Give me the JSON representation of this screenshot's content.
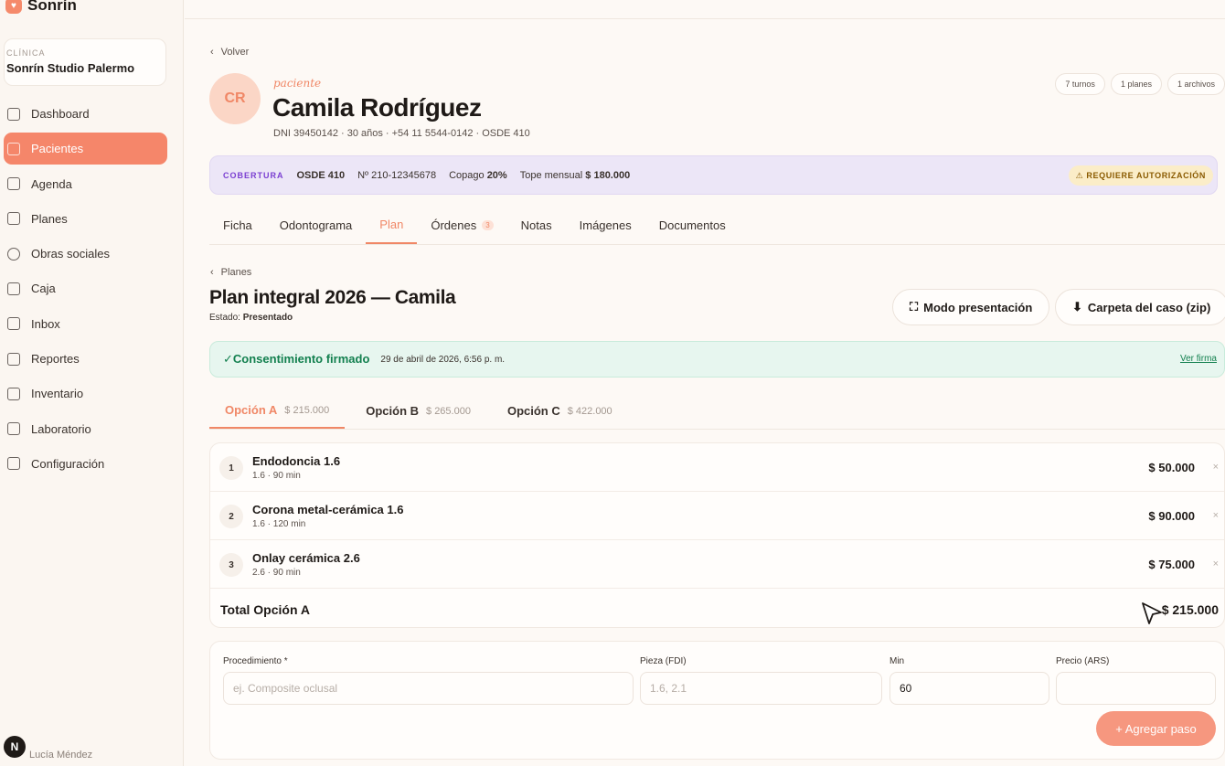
{
  "brand": {
    "name": "Sonrín"
  },
  "clinic": {
    "label": "CLÍNICA",
    "name": "Sonrín Studio Palermo"
  },
  "sidebar": {
    "items": [
      {
        "label": "Dashboard",
        "icon": "home-icon",
        "active": false
      },
      {
        "label": "Pacientes",
        "icon": "users-icon",
        "active": true
      },
      {
        "label": "Agenda",
        "icon": "calendar-icon",
        "active": false
      },
      {
        "label": "Planes",
        "icon": "document-icon",
        "active": false
      },
      {
        "label": "Obras sociales",
        "icon": "shield-icon",
        "active": false
      },
      {
        "label": "Caja",
        "icon": "folder-icon",
        "active": false
      },
      {
        "label": "Inbox",
        "icon": "chat-icon",
        "active": false
      },
      {
        "label": "Reportes",
        "icon": "chart-icon",
        "active": false
      },
      {
        "label": "Inventario",
        "icon": "box-icon",
        "active": false
      },
      {
        "label": "Laboratorio",
        "icon": "flask-icon",
        "active": false
      },
      {
        "label": "Configuración",
        "icon": "gear-icon",
        "active": false
      }
    ]
  },
  "user": {
    "initial": "N",
    "name": "Lucía Méndez"
  },
  "header": {
    "back_label": "Volver"
  },
  "patient": {
    "initials": "CR",
    "tag": "paciente",
    "name": "Camila Rodríguez",
    "meta": "DNI 39450142 · 30 años · +54 11 5544-0142 · OSDE 410",
    "chips": [
      "7 turnos",
      "1 planes",
      "1 archivos"
    ]
  },
  "coverage": {
    "label": "COBERTURA",
    "plan": "OSDE 410",
    "number": "Nº 210-12345678",
    "copay_label": "Copago",
    "copay_value": "20%",
    "cap_label": "Tope mensual",
    "cap_value": "$ 180.000",
    "warning": "⚠ REQUIERE AUTORIZACIÓN"
  },
  "tabs": [
    {
      "label": "Ficha",
      "active": false
    },
    {
      "label": "Odontograma",
      "active": false
    },
    {
      "label": "Plan",
      "active": true
    },
    {
      "label": "Órdenes",
      "badge": "3",
      "active": false
    },
    {
      "label": "Notas",
      "active": false
    },
    {
      "label": "Imágenes",
      "active": false
    },
    {
      "label": "Documentos",
      "active": false
    }
  ],
  "plan": {
    "crumb": "Planes",
    "title": "Plan integral 2026 — Camila",
    "state_label": "Estado:",
    "state_value": "Presentado",
    "btn_present": "Modo presentación",
    "btn_zip": "Carpeta del caso (zip)"
  },
  "consent": {
    "title": "✓Consentimiento firmado",
    "date": "29 de abril de 2026, 6:56 p. m.",
    "link": "Ver firma"
  },
  "options": [
    {
      "label": "Opción A",
      "price": "$ 215.000",
      "active": true
    },
    {
      "label": "Opción B",
      "price": "$ 265.000",
      "active": false
    },
    {
      "label": "Opción C",
      "price": "$ 422.000",
      "active": false
    }
  ],
  "steps": [
    {
      "num": "1",
      "name": "Endodoncia 1.6",
      "sub": "1.6 · 90 min",
      "price": "$ 50.000"
    },
    {
      "num": "2",
      "name": "Corona metal-cerámica 1.6",
      "sub": "1.6 · 120 min",
      "price": "$ 90.000"
    },
    {
      "num": "3",
      "name": "Onlay cerámica 2.6",
      "sub": "2.6 · 90 min",
      "price": "$ 75.000"
    }
  ],
  "total": {
    "label": "Total Opción A",
    "value": "$ 215.000"
  },
  "form": {
    "proc_label": "Procedimiento *",
    "proc_placeholder": "ej. Composite oclusal",
    "pieza_label": "Pieza (FDI)",
    "pieza_placeholder": "1.6, 2.1",
    "min_label": "Min",
    "min_value": "60",
    "precio_label": "Precio (ARS)",
    "precio_value": "",
    "add_button": "+ Agregar paso"
  },
  "colors": {
    "accent": "#f5866a",
    "coverage_bg": "#ece6f7",
    "consent_bg": "#e7f6ef",
    "warning_bg": "#fbedc8"
  }
}
